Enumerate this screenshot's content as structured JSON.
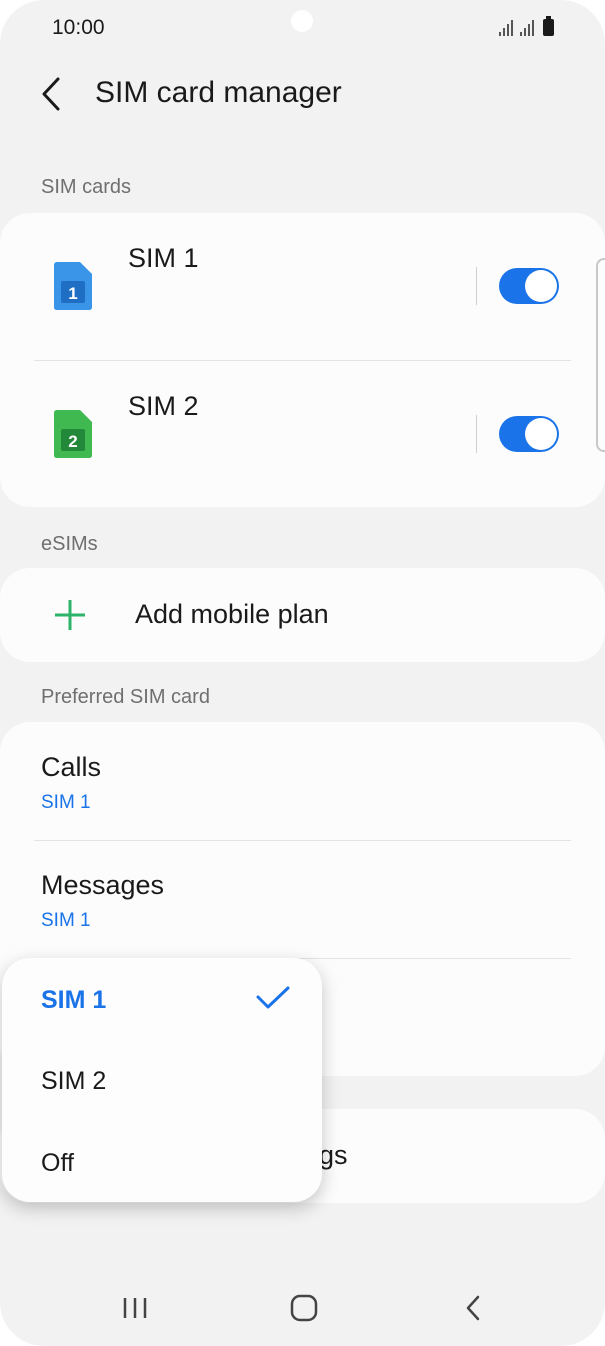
{
  "status_bar": {
    "time": "10:00"
  },
  "header": {
    "title": "SIM card manager"
  },
  "sim_cards": {
    "section_label": "SIM cards",
    "items": [
      {
        "label": "SIM 1",
        "icon_number": "1",
        "icon_color": "#3a95e8",
        "enabled": true
      },
      {
        "label": "SIM 2",
        "icon_number": "2",
        "icon_color": "#3fb950",
        "enabled": true
      }
    ]
  },
  "esims": {
    "section_label": "eSIMs",
    "add_label": "Add mobile plan"
  },
  "preferred": {
    "section_label": "Preferred SIM card",
    "items": [
      {
        "title": "Calls",
        "value": "SIM 1"
      },
      {
        "title": "Messages",
        "value": "SIM 1"
      }
    ]
  },
  "obscured_card": {
    "partial_text": "gs"
  },
  "popup_menu": {
    "options": [
      {
        "label": "SIM 1",
        "selected": true
      },
      {
        "label": "SIM 2",
        "selected": false
      },
      {
        "label": "Off",
        "selected": false
      }
    ]
  },
  "colors": {
    "accent": "#1a73e8",
    "background": "#f2f2f2",
    "card": "#fcfcfc",
    "plus": "#2db36a"
  }
}
